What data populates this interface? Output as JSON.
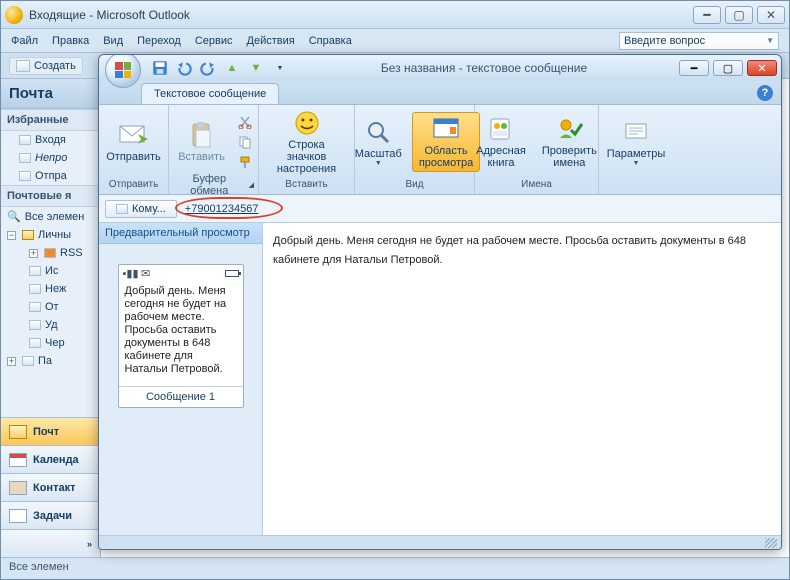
{
  "outer": {
    "title": "Входящие - Microsoft Outlook",
    "menu": [
      "Файл",
      "Правка",
      "Вид",
      "Переход",
      "Сервис",
      "Действия",
      "Справка"
    ],
    "search_placeholder": "Введите вопрос",
    "toolbar_new": "Создать",
    "status": "Все элемен"
  },
  "nav": {
    "header": "Почта",
    "fav_section": "Избранные",
    "fav_items": [
      "Входя",
      "Непро",
      "Отпра"
    ],
    "boxes_section": "Почтовые я",
    "all_label": "Все элемен",
    "personal": "Личны",
    "tree": [
      "RSS",
      "Ис",
      "Неж",
      "От",
      "Уд",
      "Чер"
    ],
    "archive": "Па",
    "bottom": {
      "mail": "Почт",
      "cal": "Календа",
      "con": "Контакт",
      "task": "Задачи"
    }
  },
  "inner": {
    "title": "Без названия - текстовое сообщение",
    "tab": "Текстовое сообщение",
    "groups": {
      "send": {
        "btn": "Отправить",
        "label": "Отправить"
      },
      "paste": {
        "btn": "Вставить",
        "label": "Буфер обмена"
      },
      "emoticon": {
        "btn": "Строка значков\nнастроения",
        "label": "Вставить"
      },
      "zoom": {
        "btn": "Масштаб",
        "label": "Вид"
      },
      "viewport": {
        "btn": "Область\nпросмотра"
      },
      "address": {
        "btn": "Адресная\nкнига"
      },
      "check": {
        "btn": "Проверить\nимена"
      },
      "names_label": "Имена",
      "params": {
        "btn": "Параметры"
      }
    },
    "to_label": "Кому...",
    "to_value": "+79001234567",
    "preview_head": "Предварительный просмотр",
    "message": "Добрый день. Меня сегодня не будет на рабочем месте. Просьба оставить документы в 648 кабинете для Натальи Петровой.",
    "phone_footer": "Сообщение 1"
  }
}
